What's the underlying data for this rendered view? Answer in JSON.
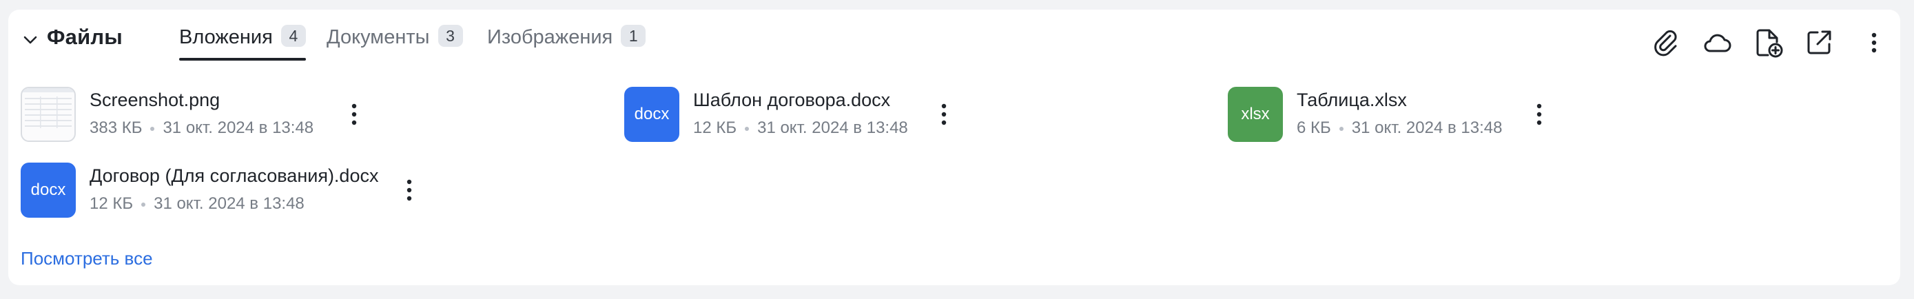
{
  "section": {
    "title": "Файлы",
    "collapse_icon": "chevron-down-icon"
  },
  "tabs": [
    {
      "label": "Вложения",
      "count": "4",
      "active": true
    },
    {
      "label": "Документы",
      "count": "3",
      "active": false
    },
    {
      "label": "Изображения",
      "count": "1",
      "active": false
    }
  ],
  "toolbar_icons": [
    "paperclip-icon",
    "cloud-icon",
    "new-document-icon",
    "open-external-icon",
    "more-vertical-icon"
  ],
  "files": [
    {
      "name": "Screenshot.png",
      "size": "383 КБ",
      "date": "31 окт. 2024 в 13:48",
      "thumb": "image-preview",
      "thumb_label": ""
    },
    {
      "name": "Шаблон договора.docx",
      "size": "12 КБ",
      "date": "31 окт. 2024 в 13:48",
      "thumb": "docx",
      "thumb_label": "docx",
      "color": "#2f6fed"
    },
    {
      "name": "Таблица.xlsx",
      "size": "6 КБ",
      "date": "31 окт. 2024 в 13:48",
      "thumb": "xlsx",
      "thumb_label": "xlsx",
      "color": "#4e9e52"
    },
    {
      "name": "Договор (Для согласования).docx",
      "size": "12 КБ",
      "date": "31 окт. 2024 в 13:48",
      "thumb": "docx",
      "thumb_label": "docx",
      "color": "#2f6fed"
    }
  ],
  "view_all_label": "Посмотреть все",
  "colors": {
    "accent": "#2b6de0",
    "docx": "#2f6fed",
    "xlsx": "#4e9e52"
  }
}
